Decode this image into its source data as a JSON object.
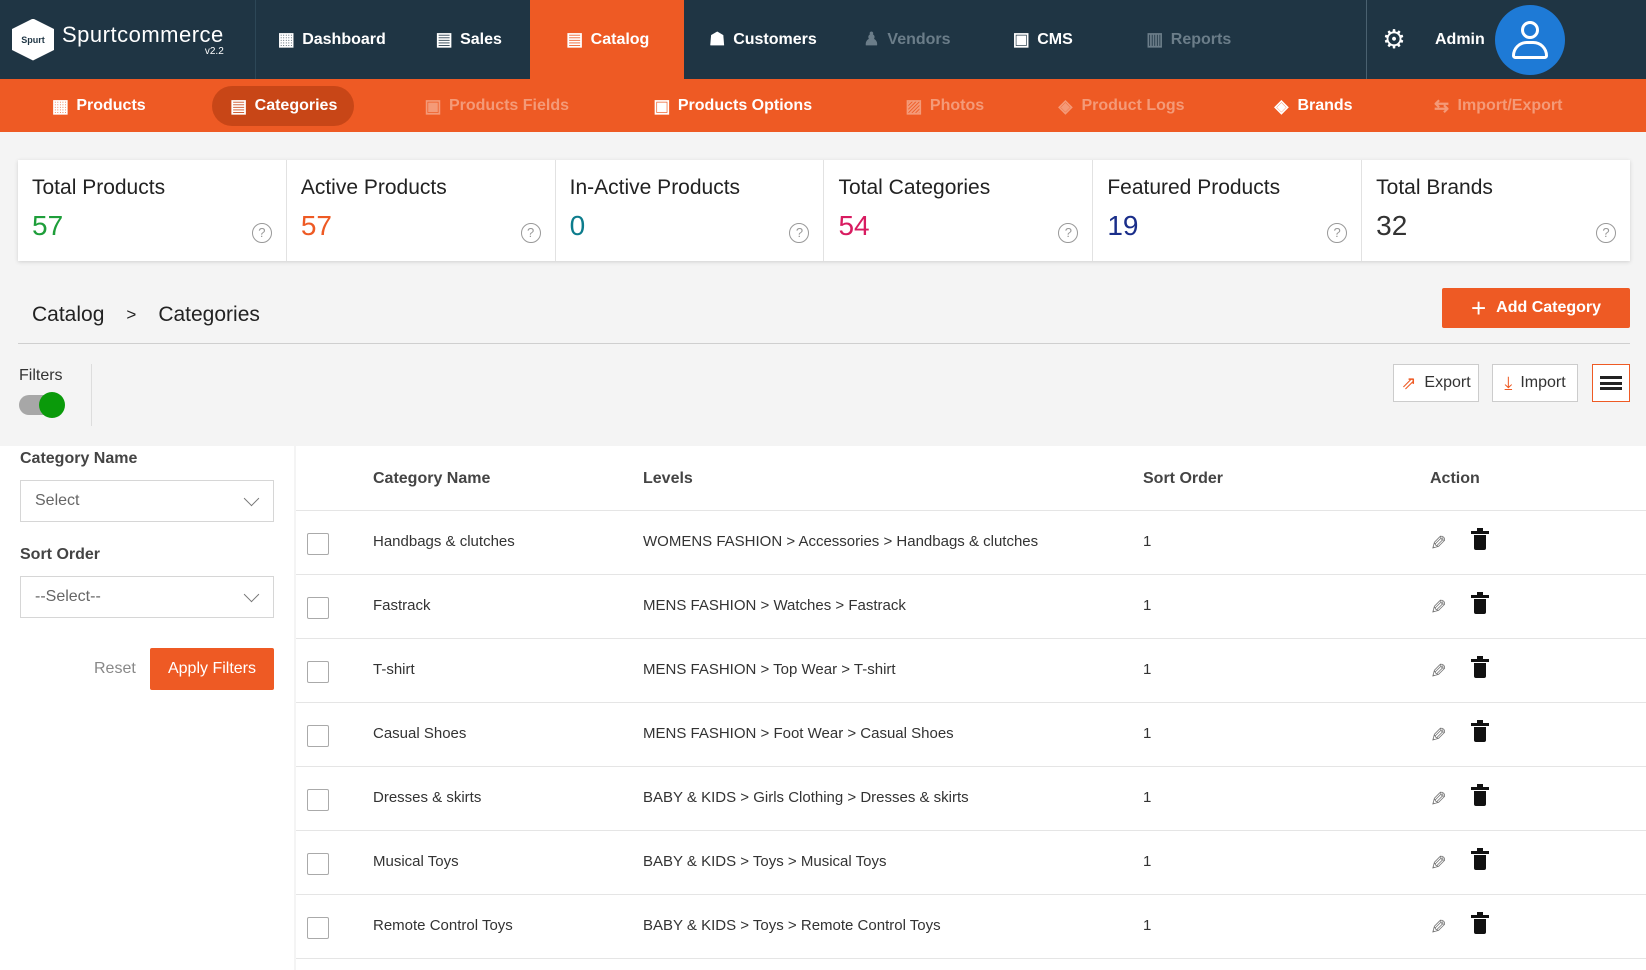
{
  "brand": {
    "name": "Spurtcommerce",
    "version": "v2.2",
    "badge": "Spurt"
  },
  "topnav": [
    {
      "label": "Dashboard",
      "icon": "chart-icon",
      "glyph": "▦"
    },
    {
      "label": "Sales",
      "icon": "clipboard-icon",
      "glyph": "▤"
    },
    {
      "label": "Catalog",
      "icon": "catalog-icon",
      "glyph": "▤"
    },
    {
      "label": "Customers",
      "icon": "customers-icon",
      "glyph": "☗"
    },
    {
      "label": "Vendors",
      "icon": "vendor-icon",
      "glyph": "♟"
    },
    {
      "label": "CMS",
      "icon": "cms-icon",
      "glyph": "▣"
    },
    {
      "label": "Reports",
      "icon": "reports-icon",
      "glyph": "▥"
    }
  ],
  "admin": {
    "name": "Admin"
  },
  "subnav": [
    {
      "label": "Products",
      "icon": "products-icon",
      "glyph": "▦"
    },
    {
      "label": "Categories",
      "icon": "categories-icon",
      "glyph": "▤"
    },
    {
      "label": "Products Fields",
      "icon": "fields-icon",
      "glyph": "▣"
    },
    {
      "label": "Products Options",
      "icon": "options-icon",
      "glyph": "▣"
    },
    {
      "label": "Photos",
      "icon": "photos-icon",
      "glyph": "▨"
    },
    {
      "label": "Product Logs",
      "icon": "logs-icon",
      "glyph": "◈"
    },
    {
      "label": "Brands",
      "icon": "brands-icon",
      "glyph": "◈"
    },
    {
      "label": "Import/Export",
      "icon": "import-export-icon",
      "glyph": "⇆"
    }
  ],
  "stats": [
    {
      "label": "Total Products",
      "value": "57",
      "color": "#1e9e3a"
    },
    {
      "label": "Active Products",
      "value": "57",
      "color": "#ee5a24"
    },
    {
      "label": "In-Active Products",
      "value": "0",
      "color": "#0c7c8c"
    },
    {
      "label": "Total Categories",
      "value": "54",
      "color": "#d81b60"
    },
    {
      "label": "Featured Products",
      "value": "19",
      "color": "#1a2e8a"
    },
    {
      "label": "Total Brands",
      "value": "32",
      "color": "#333333"
    }
  ],
  "breadcrumb": {
    "root": "Catalog",
    "sep": ">",
    "current": "Categories"
  },
  "add_button": {
    "label": "Add Category"
  },
  "filters": {
    "label": "Filters",
    "category_name_label": "Category Name",
    "category_name_value": "Select",
    "sort_order_label": "Sort Order",
    "sort_order_value": "--Select--",
    "reset": "Reset",
    "apply": "Apply Filters"
  },
  "toolbar": {
    "export": "Export",
    "import": "Import"
  },
  "table": {
    "headers": {
      "name": "Category Name",
      "levels": "Levels",
      "sort": "Sort Order",
      "action": "Action"
    },
    "rows": [
      {
        "name": "Handbags & clutches",
        "levels": "WOMENS FASHION > Accessories > Handbags & clutches",
        "sort": "1"
      },
      {
        "name": "Fastrack",
        "levels": "MENS FASHION > Watches > Fastrack",
        "sort": "1"
      },
      {
        "name": "T-shirt",
        "levels": "MENS FASHION > Top Wear > T-shirt",
        "sort": "1"
      },
      {
        "name": "Casual Shoes",
        "levels": "MENS FASHION > Foot Wear > Casual Shoes",
        "sort": "1"
      },
      {
        "name": "Dresses & skirts",
        "levels": "BABY & KIDS > Girls Clothing > Dresses & skirts",
        "sort": "1"
      },
      {
        "name": "Musical Toys",
        "levels": "BABY & KIDS > Toys > Musical Toys",
        "sort": "1"
      },
      {
        "name": "Remote Control Toys",
        "levels": "BABY & KIDS > Toys > Remote Control Toys",
        "sort": "1"
      }
    ]
  }
}
